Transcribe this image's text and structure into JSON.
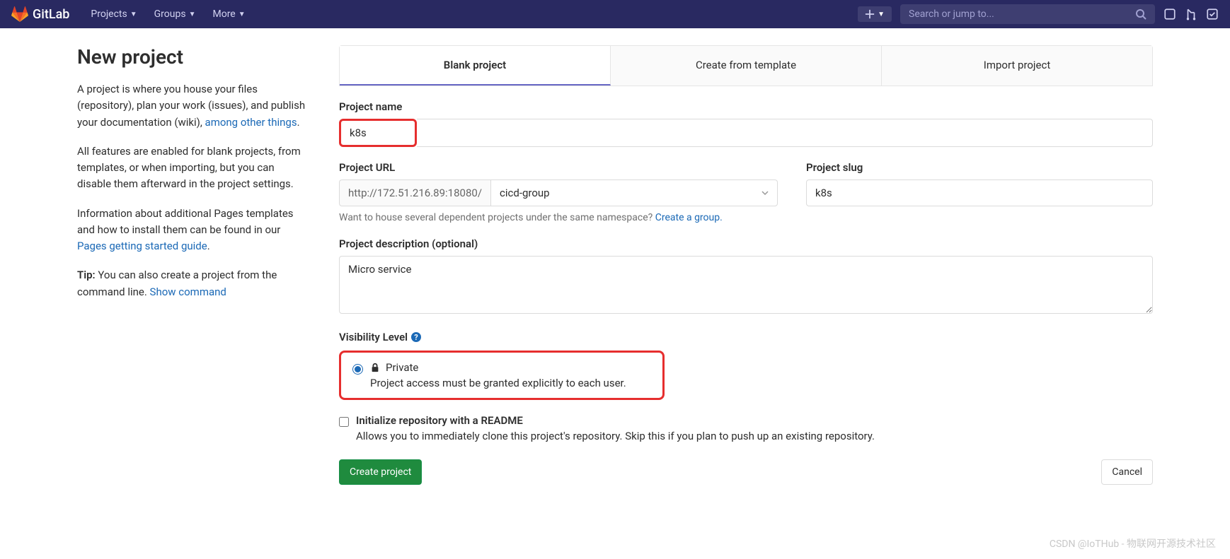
{
  "navbar": {
    "brand": "GitLab",
    "items": [
      "Projects",
      "Groups",
      "More"
    ],
    "search_placeholder": "Search or jump to..."
  },
  "sidebar": {
    "title": "New project",
    "p1_a": "A project is where you house your files (repository), plan your work (issues), and publish your documentation (wiki), ",
    "p1_link": "among other things",
    "p1_b": ".",
    "p2": "All features are enabled for blank projects, from templates, or when importing, but you can disable them afterward in the project settings.",
    "p3_a": "Information about additional Pages templates and how to install them can be found in our ",
    "p3_link": "Pages getting started guide",
    "p3_b": ".",
    "tip_label": "Tip:",
    "tip_text": " You can also create a project from the command line. ",
    "tip_link": "Show command"
  },
  "tabs": {
    "blank": "Blank project",
    "template": "Create from template",
    "import": "Import project"
  },
  "form": {
    "name_label": "Project name",
    "name_value": "k8s",
    "url_label": "Project URL",
    "url_prefix": "http://172.51.216.89:18080/",
    "namespace": "cicd-group",
    "slug_label": "Project slug",
    "slug_value": "k8s",
    "helper_a": "Want to house several dependent projects under the same namespace? ",
    "helper_link": "Create a group.",
    "desc_label": "Project description (optional)",
    "desc_value": "Micro service",
    "visibility_label": "Visibility Level",
    "private_title": "Private",
    "private_desc": "Project access must be granted explicitly to each user.",
    "readme_label": "Initialize repository with a README",
    "readme_desc": "Allows you to immediately clone this project's repository. Skip this if you plan to push up an existing repository.",
    "create_btn": "Create project",
    "cancel_btn": "Cancel"
  },
  "watermark": "CSDN @IoTHub - 物联网开源技术社区"
}
